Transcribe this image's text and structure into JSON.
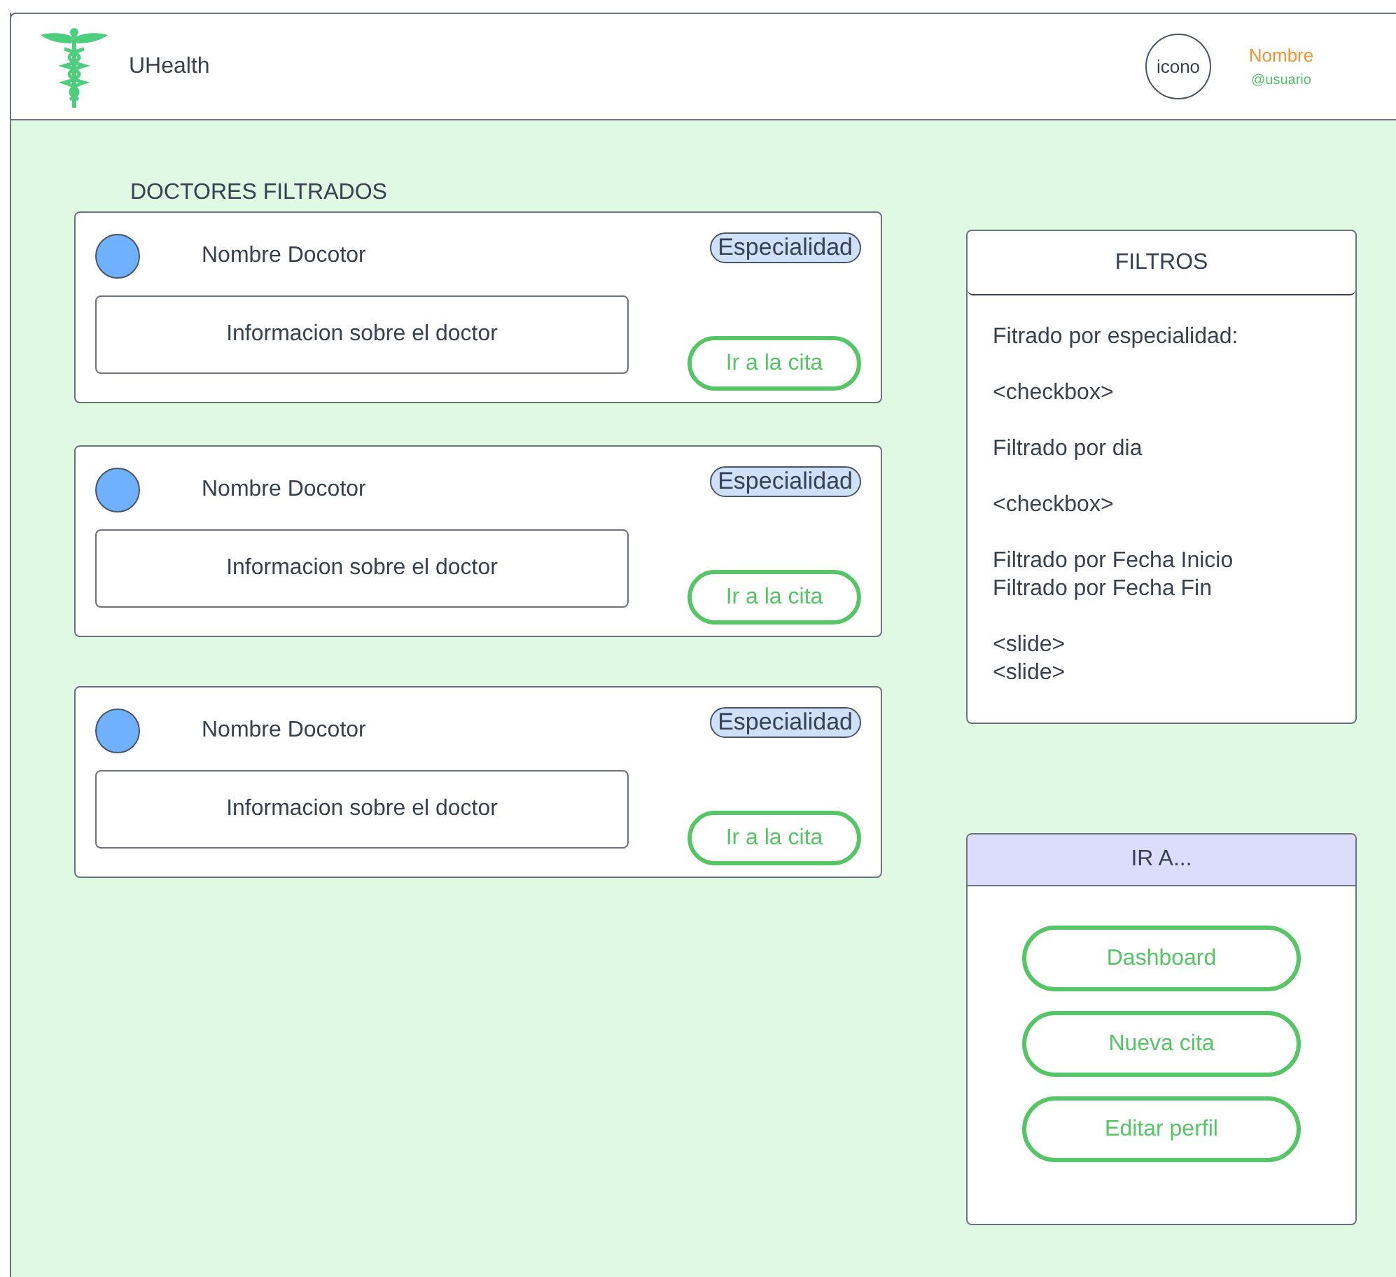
{
  "header": {
    "app_name": "UHealth",
    "avatar_label": "icono",
    "user_name": "Nombre",
    "user_handle": "@usuario"
  },
  "section_title": "DOCTORES FILTRADOS",
  "doctors": [
    {
      "name": "Nombre Docotor",
      "specialty": "Especialidad",
      "info": "Informacion sobre el doctor",
      "button": "Ir a la cita"
    },
    {
      "name": "Nombre Docotor",
      "specialty": "Especialidad",
      "info": "Informacion sobre el doctor",
      "button": "Ir a la cita"
    },
    {
      "name": "Nombre Docotor",
      "specialty": "Especialidad",
      "info": "Informacion sobre el doctor",
      "button": "Ir a la cita"
    }
  ],
  "filters": {
    "title": "FILTROS",
    "groups": [
      [
        "Fitrado por especialidad:"
      ],
      [
        "<checkbox>"
      ],
      [
        "Filtrado por dia"
      ],
      [
        "<checkbox>"
      ],
      [
        "Filtrado por Fecha Inicio",
        "Filtrado por Fecha Fin"
      ],
      [
        "<slide>",
        "<slide>"
      ]
    ]
  },
  "navigation": {
    "title": "IR A...",
    "buttons": [
      "Dashboard",
      "Nueva cita",
      "Editar perfil"
    ]
  }
}
